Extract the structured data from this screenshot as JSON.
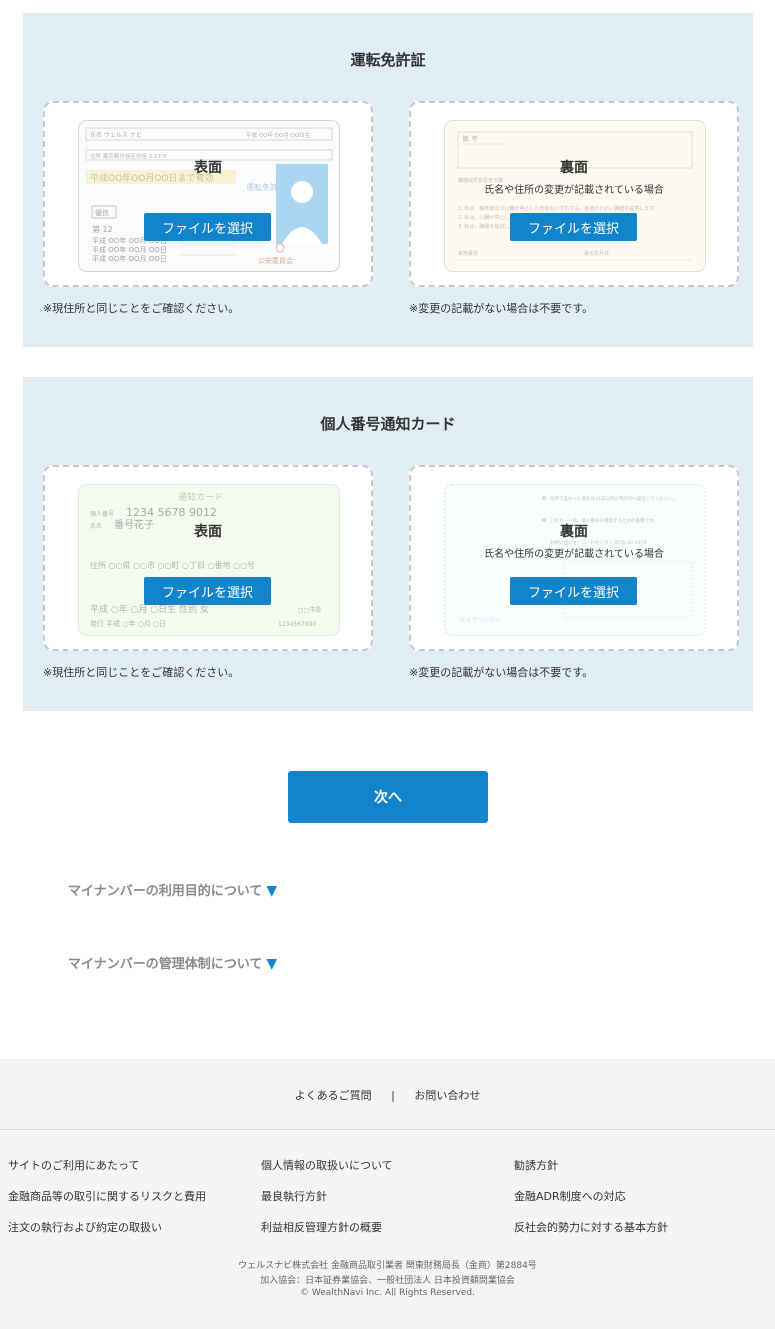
{
  "license_section": {
    "title": "運転免許証",
    "front": {
      "label": "表面",
      "button": "ファイルを選択",
      "note": "※現住所と同じことをご確認ください。"
    },
    "back": {
      "label": "裏面",
      "sub": "氏名や住所の変更が記載されている場合",
      "button": "ファイルを選択",
      "note": "※変更の記載がない場合は不要です。"
    }
  },
  "mynumber_section": {
    "title": "個人番号通知カード",
    "front": {
      "label": "表面",
      "button": "ファイルを選択",
      "note": "※現住所と同じことをご確認ください。"
    },
    "back": {
      "label": "裏面",
      "sub": "氏名や住所の変更が記載されている場合",
      "button": "ファイルを選択",
      "note": "※変更の記載がない場合は不要です。"
    }
  },
  "next_button": "次へ",
  "accordions": [
    {
      "label": "マイナンバーの利用目的について",
      "icon": "triangle-down-icon"
    },
    {
      "label": "マイナンバーの管理体制について",
      "icon": "triangle-down-icon"
    }
  ],
  "footer": {
    "top_links": [
      "よくあるご質問",
      "お問い合わせ"
    ],
    "separator": "|",
    "columns": [
      [
        "サイトのご利用にあたって",
        "金融商品等の取引に関するリスクと費用",
        "注文の執行および約定の取扱い"
      ],
      [
        "個人情報の取扱いについて",
        "最良執行方針",
        "利益相反管理方針の概要"
      ],
      [
        "勧誘方針",
        "金融ADR制度への対応",
        "反社会的勢力に対する基本方針"
      ]
    ],
    "company": "ウェルスナビ株式会社 金融商品取引業者 関東財務局長（金商）第2884号",
    "associations": "加入協会：日本証券業協会、一般社団法人 日本投資顧問業協会",
    "copyright": "© WealthNavi Inc. All Rights Reserved."
  },
  "colors": {
    "accent": "#1284cb",
    "section_bg": "#e1edf5",
    "footer_bg": "#f4f4f4"
  },
  "card_art": {
    "license_front": {
      "name_row": "氏名 ウェルス ナビ",
      "birth": "平成 OO年 OO月 OO日生",
      "address": "住所 東京都渋谷区渋谷 2-17-5",
      "expiry": "平成OO年OO月OO日まで有効",
      "kind": "優良",
      "number": "第 12",
      "era1": "平成 OO年 OO月 OO日",
      "era2": "平成 OO年 OO月 OO日",
      "era3": "平成 OO年 OO月 OO日",
      "license_text": "運転免許",
      "seal": "公安委員会"
    },
    "license_back": {
      "header": "備 考",
      "line1": "臓器提供意思表示欄",
      "line2": "1. 私は、脳死後及び心臓が停止した死後のいずれでも、移植のために臓器を提供します。",
      "line3": "2. 私は、心臓が停止した死後に限り、移植のために臓器を提供します。",
      "line4": "3. 私は、臓器を提供しません。",
      "sign": "署名年月日",
      "family": "家族署名"
    },
    "mynumber_front": {
      "title": "通知カード",
      "number_label": "個人番号",
      "number": "1234 5678 9012",
      "name_label": "氏名",
      "name": "番号花子",
      "address": "住所 ○○県 ○○市 ○○町 ○丁目 ○番地 ○○号",
      "birth": "平成 ○年 ○月 ○日生 性別 女",
      "issue": "発行 平成 ○年 ○月 ○日",
      "city": "□□市長",
      "serial": "1234567890"
    },
    "mynumber_back": {
      "note1": "住所で変わった場合は14日以内に市町村へ届出してください。",
      "note2": "このカードは、個人番号を確認するための書類です。",
      "note3": "お問い合わせ：コールセンター 0570-20-0178",
      "footer": "マイナンバー"
    }
  }
}
